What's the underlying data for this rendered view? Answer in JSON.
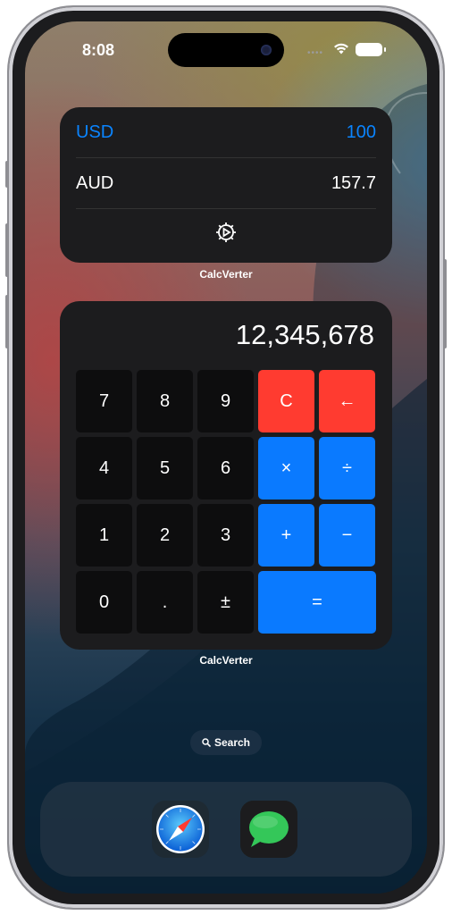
{
  "status_bar": {
    "time": "8:08",
    "signal_icon": "signal-dots-icon",
    "wifi_icon": "wifi-icon",
    "battery_icon": "battery-icon"
  },
  "currency_widget": {
    "base_currency": "USD",
    "base_amount": "100",
    "target_currency": "AUD",
    "target_amount": "157.7",
    "settings_icon": "gear-icon",
    "label": "CalcVerter",
    "accent_color": "#0a84ff"
  },
  "calculator_widget": {
    "display": "12,345,678",
    "keys": {
      "seven": "7",
      "eight": "8",
      "nine": "9",
      "clear": "C",
      "backspace": "←",
      "four": "4",
      "five": "5",
      "six": "6",
      "multiply": "×",
      "divide": "÷",
      "one": "1",
      "two": "2",
      "three": "3",
      "plus": "+",
      "minus": "−",
      "zero": "0",
      "decimal": ".",
      "sign": "±",
      "equals": "="
    },
    "label": "CalcVerter",
    "clear_color": "#ff3b30",
    "operator_color": "#0a7aff"
  },
  "search": {
    "label": "Search",
    "icon": "magnifier-icon"
  },
  "dock": {
    "apps": [
      {
        "name": "Safari",
        "icon": "safari-compass-icon"
      },
      {
        "name": "Messages",
        "icon": "messages-bubble-icon"
      }
    ]
  }
}
